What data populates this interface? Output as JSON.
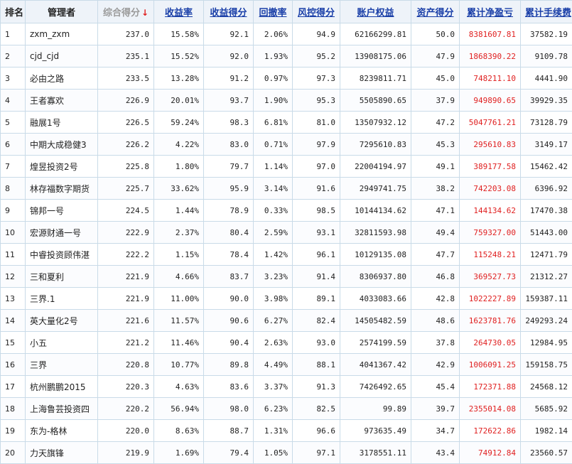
{
  "headers": {
    "rank": "排名",
    "manager": "管理者",
    "composite": "综合得分",
    "return_rate": "收益率",
    "return_score": "收益得分",
    "drawdown": "回撤率",
    "risk_score": "风控得分",
    "equity": "账户权益",
    "asset_score": "资产得分",
    "net_pnl": "累计净盈亏",
    "fees": "累计手续费"
  },
  "sort_indicator": "↓",
  "colors": {
    "pnl": "#e02020",
    "link": "#1a3fa8",
    "header_bg": "#eef3f9",
    "border": "#c9dbe8"
  },
  "rows": [
    {
      "rank": "1",
      "manager": "zxm_zxm",
      "composite": "237.0",
      "return_rate": "15.58%",
      "return_score": "92.1",
      "drawdown": "2.06%",
      "risk_score": "94.9",
      "equity": "62166299.81",
      "asset_score": "50.0",
      "net_pnl": "8381607.81",
      "fees": "37582.19"
    },
    {
      "rank": "2",
      "manager": "cjd_cjd",
      "composite": "235.1",
      "return_rate": "15.52%",
      "return_score": "92.0",
      "drawdown": "1.93%",
      "risk_score": "95.2",
      "equity": "13908175.06",
      "asset_score": "47.9",
      "net_pnl": "1868390.22",
      "fees": "9109.78"
    },
    {
      "rank": "3",
      "manager": "必由之路",
      "composite": "233.5",
      "return_rate": "13.28%",
      "return_score": "91.2",
      "drawdown": "0.97%",
      "risk_score": "97.3",
      "equity": "8239811.71",
      "asset_score": "45.0",
      "net_pnl": "748211.10",
      "fees": "4441.90"
    },
    {
      "rank": "4",
      "manager": "王者寡欢",
      "composite": "226.9",
      "return_rate": "20.01%",
      "return_score": "93.7",
      "drawdown": "1.90%",
      "risk_score": "95.3",
      "equity": "5505890.65",
      "asset_score": "37.9",
      "net_pnl": "949890.65",
      "fees": "39929.35"
    },
    {
      "rank": "5",
      "manager": "融展1号",
      "composite": "226.5",
      "return_rate": "59.24%",
      "return_score": "98.3",
      "drawdown": "6.81%",
      "risk_score": "81.0",
      "equity": "13507932.12",
      "asset_score": "47.2",
      "net_pnl": "5047761.21",
      "fees": "73128.79"
    },
    {
      "rank": "6",
      "manager": "中期大成稳健3",
      "composite": "226.2",
      "return_rate": "4.22%",
      "return_score": "83.0",
      "drawdown": "0.71%",
      "risk_score": "97.9",
      "equity": "7295610.83",
      "asset_score": "45.3",
      "net_pnl": "295610.83",
      "fees": "3149.17"
    },
    {
      "rank": "7",
      "manager": "煌昱投资2号",
      "composite": "225.8",
      "return_rate": "1.80%",
      "return_score": "79.7",
      "drawdown": "1.14%",
      "risk_score": "97.0",
      "equity": "22004194.97",
      "asset_score": "49.1",
      "net_pnl": "389177.58",
      "fees": "15462.42"
    },
    {
      "rank": "8",
      "manager": "林存福数字期货",
      "composite": "225.7",
      "return_rate": "33.62%",
      "return_score": "95.9",
      "drawdown": "3.14%",
      "risk_score": "91.6",
      "equity": "2949741.75",
      "asset_score": "38.2",
      "net_pnl": "742203.08",
      "fees": "6396.92"
    },
    {
      "rank": "9",
      "manager": "锦邦一号",
      "composite": "224.5",
      "return_rate": "1.44%",
      "return_score": "78.9",
      "drawdown": "0.33%",
      "risk_score": "98.5",
      "equity": "10144134.62",
      "asset_score": "47.1",
      "net_pnl": "144134.62",
      "fees": "17470.38"
    },
    {
      "rank": "10",
      "manager": "宏源财通一号",
      "composite": "222.9",
      "return_rate": "2.37%",
      "return_score": "80.4",
      "drawdown": "2.59%",
      "risk_score": "93.1",
      "equity": "32811593.98",
      "asset_score": "49.4",
      "net_pnl": "759327.00",
      "fees": "51443.00"
    },
    {
      "rank": "11",
      "manager": "中睿投资顾伟湛",
      "composite": "222.2",
      "return_rate": "1.15%",
      "return_score": "78.4",
      "drawdown": "1.42%",
      "risk_score": "96.1",
      "equity": "10129135.08",
      "asset_score": "47.7",
      "net_pnl": "115248.21",
      "fees": "12471.79"
    },
    {
      "rank": "12",
      "manager": "三和夏利",
      "composite": "221.9",
      "return_rate": "4.66%",
      "return_score": "83.7",
      "drawdown": "3.23%",
      "risk_score": "91.4",
      "equity": "8306937.80",
      "asset_score": "46.8",
      "net_pnl": "369527.73",
      "fees": "21312.27"
    },
    {
      "rank": "13",
      "manager": "三界.1",
      "composite": "221.9",
      "return_rate": "11.00%",
      "return_score": "90.0",
      "drawdown": "3.98%",
      "risk_score": "89.1",
      "equity": "4033083.66",
      "asset_score": "42.8",
      "net_pnl": "1022227.89",
      "fees": "159387.11"
    },
    {
      "rank": "14",
      "manager": "英大量化2号",
      "composite": "221.6",
      "return_rate": "11.57%",
      "return_score": "90.6",
      "drawdown": "6.27%",
      "risk_score": "82.4",
      "equity": "14505482.59",
      "asset_score": "48.6",
      "net_pnl": "1623781.76",
      "fees": "249293.24"
    },
    {
      "rank": "15",
      "manager": "小五",
      "composite": "221.2",
      "return_rate": "11.46%",
      "return_score": "90.4",
      "drawdown": "2.63%",
      "risk_score": "93.0",
      "equity": "2574199.59",
      "asset_score": "37.8",
      "net_pnl": "264730.05",
      "fees": "12984.95"
    },
    {
      "rank": "16",
      "manager": "三界",
      "composite": "220.8",
      "return_rate": "10.77%",
      "return_score": "89.8",
      "drawdown": "4.49%",
      "risk_score": "88.1",
      "equity": "4041367.42",
      "asset_score": "42.9",
      "net_pnl": "1006091.25",
      "fees": "159158.75"
    },
    {
      "rank": "17",
      "manager": "杭州鹏鹏2015",
      "composite": "220.3",
      "return_rate": "4.63%",
      "return_score": "83.6",
      "drawdown": "3.37%",
      "risk_score": "91.3",
      "equity": "7426492.65",
      "asset_score": "45.4",
      "net_pnl": "172371.88",
      "fees": "24568.12"
    },
    {
      "rank": "18",
      "manager": "上海鲁芸投资四",
      "composite": "220.2",
      "return_rate": "56.94%",
      "return_score": "98.0",
      "drawdown": "6.23%",
      "risk_score": "82.5",
      "equity": "99.89",
      "asset_score": "39.7",
      "net_pnl": "2355014.08",
      "fees": "5685.92"
    },
    {
      "rank": "19",
      "manager": "东为-格林",
      "composite": "220.0",
      "return_rate": "8.63%",
      "return_score": "88.7",
      "drawdown": "1.31%",
      "risk_score": "96.6",
      "equity": "973635.49",
      "asset_score": "34.7",
      "net_pnl": "172622.86",
      "fees": "1982.14"
    },
    {
      "rank": "20",
      "manager": "力天旗锋",
      "composite": "219.9",
      "return_rate": "1.69%",
      "return_score": "79.4",
      "drawdown": "1.05%",
      "risk_score": "97.1",
      "equity": "3178551.11",
      "asset_score": "43.4",
      "net_pnl": "74912.84",
      "fees": "23560.57"
    }
  ]
}
